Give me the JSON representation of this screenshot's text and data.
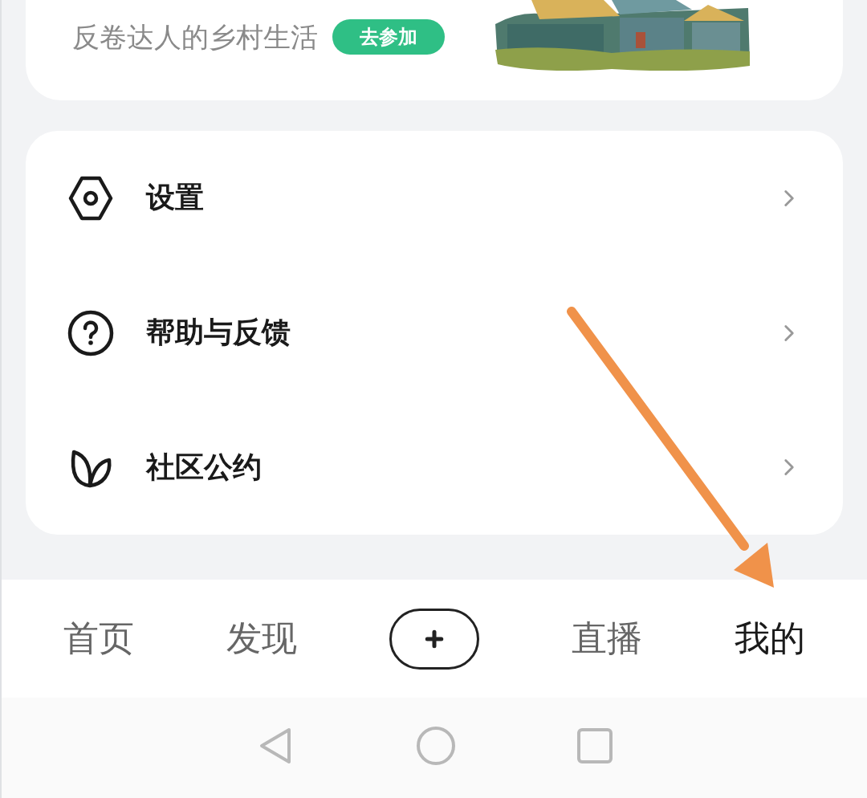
{
  "promo": {
    "subtitle": "反卷达人的乡村生活",
    "button": "去参加"
  },
  "menu": [
    {
      "kind": "settings",
      "label": "设置"
    },
    {
      "kind": "help",
      "label": "帮助与反馈"
    },
    {
      "kind": "leaf",
      "label": "社区公约"
    }
  ],
  "tabs": [
    {
      "kind": "text",
      "label": "首页",
      "selected": false
    },
    {
      "kind": "text",
      "label": "发现",
      "selected": false
    },
    {
      "kind": "plus",
      "selected": false
    },
    {
      "kind": "text",
      "label": "直播",
      "selected": false
    },
    {
      "kind": "text",
      "label": "我的",
      "selected": true
    }
  ],
  "annotation": {
    "kind": "arrow"
  }
}
